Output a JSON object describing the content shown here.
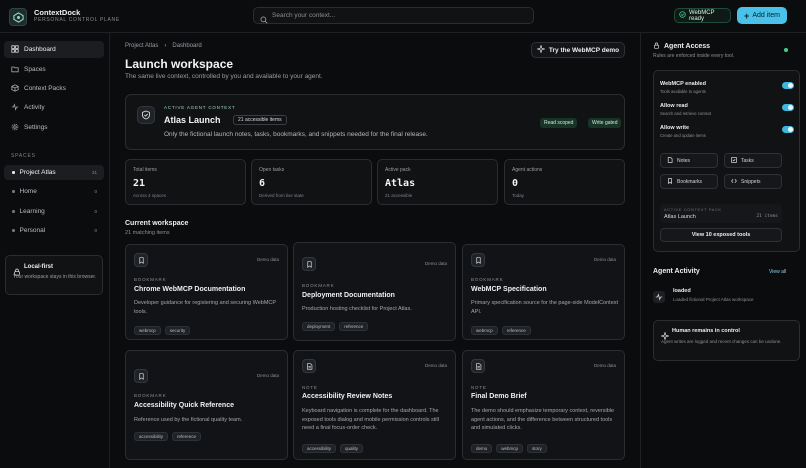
{
  "app": {
    "title": "ContextDock",
    "subtitle": "PERSONAL CONTROL PLANE"
  },
  "search": {
    "placeholder": "Search your context..."
  },
  "status": {
    "label": "WebMCP ready"
  },
  "actions": {
    "add_item": "Add item",
    "try_webmcp": "Try the WebMCP demo"
  },
  "sidebar": {
    "nav": [
      {
        "label": "Dashboard"
      },
      {
        "label": "Spaces"
      },
      {
        "label": "Context Packs"
      },
      {
        "label": "Activity"
      },
      {
        "label": "Settings"
      }
    ],
    "spaces_heading": "SPACES",
    "spaces": [
      {
        "label": "Project Atlas",
        "count": "21"
      },
      {
        "label": "Home",
        "count": "0"
      },
      {
        "label": "Learning",
        "count": "0"
      },
      {
        "label": "Personal",
        "count": "0"
      }
    ],
    "local": {
      "title": "Local-first",
      "text": "Your workspace stays in this browser."
    }
  },
  "breadcrumb": {
    "parent": "Project Atlas",
    "current": "Dashboard"
  },
  "page": {
    "title": "Launch workspace",
    "subtitle": "The same live context, controlled by you and available to your agent."
  },
  "hero": {
    "kicker": "ACTIVE AGENT CONTEXT",
    "title": "Atlas Launch",
    "badge": "21 accessible items",
    "description": "Only the fictional launch notes, tasks, bookmarks, and snippets needed for the final release.",
    "tags": [
      "Read scoped",
      "Write gated"
    ]
  },
  "stats": [
    {
      "label": "Total items",
      "value": "21",
      "note": "Across 4 spaces"
    },
    {
      "label": "Open tasks",
      "value": "6",
      "note": "Derived from live state"
    },
    {
      "label": "Active pack",
      "value": "Atlas",
      "note": "21 accessible"
    },
    {
      "label": "Agent actions",
      "value": "0",
      "note": "Today"
    }
  ],
  "workspace": {
    "title": "Current workspace",
    "subtitle": "21 matching items",
    "cards": [
      {
        "kind": "BOOKMARK",
        "demo": "Demo data",
        "title": "Chrome WebMCP Documentation",
        "desc": "Developer guidance for registering and securing WebMCP tools.",
        "tags": [
          "webmcp",
          "security"
        ]
      },
      {
        "kind": "BOOKMARK",
        "demo": "Demo data",
        "title": "Deployment Documentation",
        "desc": "Production hosting checklist for Project Atlas.",
        "tags": [
          "deployment",
          "reference"
        ]
      },
      {
        "kind": "BOOKMARK",
        "demo": "Demo data",
        "title": "WebMCP Specification",
        "desc": "Primary specification source for the page-side ModelContext API.",
        "tags": [
          "webmcp",
          "reference"
        ]
      },
      {
        "kind": "BOOKMARK",
        "demo": "Demo data",
        "title": "Accessibility Quick Reference",
        "desc": "Reference used by the fictional quality team.",
        "tags": [
          "accessibility",
          "reference"
        ]
      },
      {
        "kind": "NOTE",
        "demo": "Demo data",
        "title": "Accessibility Review Notes",
        "desc": "Keyboard navigation is complete for the dashboard. The exposed tools dialog and mobile permission controls still need a final focus-order check.",
        "tags": [
          "accessibility",
          "quality"
        ]
      },
      {
        "kind": "NOTE",
        "demo": "Demo data",
        "title": "Final Demo Brief",
        "desc": "The demo should emphasize temporary context, reversible agent actions, and the difference between structured tools and simulated clicks.",
        "tags": [
          "demo",
          "webmcp",
          "story"
        ]
      }
    ]
  },
  "agent_access": {
    "title": "Agent Access",
    "subtitle": "Rules are enforced inside every tool.",
    "toggles": [
      {
        "label": "WebMCP enabled",
        "desc": "Tools available to agents"
      },
      {
        "label": "Allow read",
        "desc": "Search and retrieve context"
      },
      {
        "label": "Allow write",
        "desc": "Create and update items"
      }
    ],
    "tools": [
      "Notes",
      "Tasks",
      "Bookmarks",
      "Snippets"
    ],
    "context": {
      "kicker": "ACTIVE CONTEXT PACK",
      "name": "Atlas Launch",
      "items": "21 items"
    },
    "view_tools": "View 10 exposed tools"
  },
  "activity": {
    "title": "Agent Activity",
    "view_all": "View all",
    "items": [
      {
        "label": "loaded",
        "desc": "Loaded fictional Project Atlas workspace"
      }
    ]
  },
  "human": {
    "title": "Human remains in control",
    "desc": "Agent writes are logged and recent changes can be undone."
  },
  "colors": {
    "accent": "#4ac1e8",
    "ready": "#3ecf8e",
    "background": "#0b0c0e"
  }
}
